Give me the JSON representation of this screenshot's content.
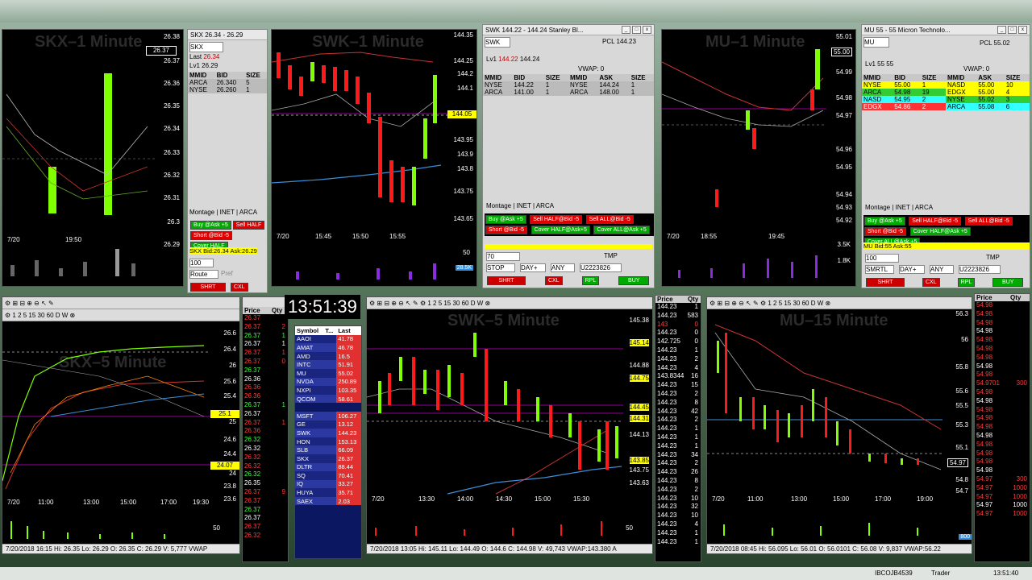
{
  "clock": "13:51:39",
  "charts": {
    "skx1": {
      "watermark": "SKX–1 Minute",
      "date": "7/20",
      "times": [
        "19:50"
      ],
      "prices": [
        "26.38",
        "26.37",
        "26.36",
        "26.35",
        "26.34",
        "26.33",
        "26.32",
        "26.31",
        "26.3",
        "26.29"
      ],
      "hl": "26.37"
    },
    "swk1": {
      "watermark": "SWK–1 Minute",
      "date": "7/20",
      "times": [
        "15:45",
        "15:50",
        "15:55"
      ],
      "prices": [
        "144.35",
        "144.25",
        "144.2",
        "144.1",
        "144.05",
        "143.95",
        "143.9",
        "143.8",
        "143.75",
        "143.65"
      ],
      "hl": "144.05",
      "vol_labels": [
        "50",
        "28.5K"
      ]
    },
    "mu1": {
      "watermark": "MU–1 Minute",
      "date": "7/20",
      "times": [
        "18:55",
        "19:45"
      ],
      "prices": [
        "55.01",
        "55.00",
        "54.99",
        "54.98",
        "54.97",
        "54.96",
        "54.95",
        "54.94",
        "54.93",
        "54.92"
      ],
      "vol_labels": [
        "3.5K",
        "1.8K"
      ]
    },
    "skx5": {
      "watermark": "SKX–5 Minute",
      "date": "7/20",
      "times": [
        "11:00",
        "13:00",
        "15:00",
        "17:00",
        "19:30"
      ],
      "prices": [
        "26.6",
        "26.4",
        "26",
        "25.6",
        "25.4",
        "25",
        "24.6",
        "24.4",
        "24",
        "23.8",
        "23.6"
      ],
      "hl": "25.1",
      "hl2": "24.07",
      "vol_label": "50",
      "status": "7/20/2018 16:15  Hi: 26.35  Lo: 26.29  O: 26.35  C: 26.29  V: 5,777  VWAP"
    },
    "swk5": {
      "watermark": "SWK–5 Minute",
      "date": "7/20",
      "times": [
        "13:30",
        "14:00",
        "14:30",
        "15:00",
        "15:30"
      ],
      "prices": [
        "145.38",
        "145.14",
        "144.88",
        "144.75",
        "144.45",
        "144.31",
        "144.13",
        "143.85",
        "143.75",
        "143.63"
      ],
      "vol_label": "50",
      "status": "7/20/2018 13:05  Hi: 145.11  Lo: 144.49  O: 144.6  C: 144.98  V: 49,743  VWAP:143.380  A"
    },
    "mu15": {
      "watermark": "MU–15 Minute",
      "date": "7/20",
      "times": [
        "11:00",
        "13:00",
        "15:00",
        "17:00",
        "19:00"
      ],
      "prices": [
        "56.3",
        "56",
        "55.8",
        "55.6",
        "55.5",
        "55.3",
        "55.1",
        "54.97",
        "54.8",
        "54.7"
      ],
      "vol_label": "800",
      "status": "7/20/2018 08:45  Hi: 56.095  Lo: 56.01  O: 56.0101  C: 56.08  V: 9,837  VWAP:56.22"
    }
  },
  "skx_lv2": {
    "title": "SKX  26.34 - 26.29",
    "symbol": "SKX",
    "last": "26.34",
    "lv1": "26.29",
    "cols": [
      "MMID",
      "BID",
      "SIZE"
    ],
    "rows": [
      [
        "ARCA",
        "26.340",
        "5"
      ],
      [
        "NYSE",
        "26.260",
        "1"
      ]
    ],
    "tabs": [
      "Montage",
      "INET",
      "ARCA"
    ],
    "bidask": "SKX Bid:26.34 Ask:26.29",
    "shares": "100",
    "route": "Route",
    "pref": "Pref",
    "shrt": "SHRT",
    "cxl": "CXL",
    "buy_ask": "Buy @Ask +5",
    "sell_half": "Sell HALF",
    "short_bid": "Short @Bid -5",
    "cover_half": "Cover HALF"
  },
  "swk_lv2": {
    "title": "SWK   144.22 - 144.24   Stanley Bl...",
    "symbol": "SWK",
    "pcl": "PCL 144.23",
    "lv1_bid": "144.22",
    "lv1_ask": "144.24",
    "vwap": "VWAP: 0",
    "cols": [
      "MMID",
      "BID",
      "SIZE",
      "MMID",
      "ASK",
      "SIZE"
    ],
    "rows": [
      [
        "NYSE",
        "144.22",
        "1",
        "NYSE",
        "144.24",
        "1"
      ],
      [
        "ARCA",
        "141.00",
        "1",
        "ARCA",
        "148.00",
        "1"
      ]
    ],
    "tabs": [
      "Montage",
      "INET",
      "ARCA"
    ],
    "buttons": [
      "Buy @Ask +5",
      "Sell HALF@Bid -5",
      "Sell ALL@Bid -5",
      "Short @Bid -5",
      "Cover HALF@Ask+5",
      "Cover ALL@Ask +5"
    ],
    "shares": "70",
    "order_type": "STOP",
    "tif": "DAY+",
    "dest": "ANY",
    "acct": "U2223826",
    "tmp": "TMP",
    "shrt": "SHRT",
    "cxl": "CXL",
    "rpl": "RPL",
    "buy": "BUY"
  },
  "mu_lv2": {
    "title": "MU   55 - 55   Micron Technolo...",
    "symbol": "MU",
    "pcl": "PCL 55.02",
    "lv1_bid": "55",
    "lv1_ask": "55",
    "vwap": "VWAP: 0",
    "cols": [
      "MMID",
      "BID",
      "SIZE",
      "MMID",
      "ASK",
      "SIZE"
    ],
    "rows": [
      [
        "NYSE",
        "55.00",
        "1",
        "NASD",
        "55.00",
        "10"
      ],
      [
        "ARCA",
        "54.98",
        "19",
        "EDGX",
        "55.00",
        "4"
      ],
      [
        "NASD",
        "54.95",
        "2",
        "NYSE",
        "55.02",
        "3"
      ],
      [
        "EDGX",
        "54.86",
        "2",
        "ARCA",
        "55.08",
        "6"
      ]
    ],
    "tabs": [
      "Montage",
      "INET",
      "ARCA"
    ],
    "buttons": [
      "Buy @Ask +5",
      "Sell HALF@Bid -5",
      "Sell ALL@Bid -5",
      "Short @Bid -5",
      "Cover HALF@Ask +5",
      "Cover ALL@Ask +5"
    ],
    "bidask": "MU Bid:55 Ask:55",
    "shares": "100",
    "dest": "SMRTL",
    "tif": "DAY+",
    "any": "ANY",
    "acct": "U2223826",
    "tmp": "TMP",
    "shrt": "SHRT",
    "cxl": "CXL",
    "rpl": "RPL",
    "buy": "BUY"
  },
  "ts_left": {
    "header": [
      "Price",
      "Qty"
    ],
    "prices": [
      "26.37",
      "26.37",
      "26.37",
      "26.37",
      "26.37",
      "26.37",
      "26.37",
      "26.36",
      "26.36",
      "26.36",
      "26.37",
      "26.37",
      "26.37",
      "26.36",
      "26.32",
      "26.32",
      "26.32",
      "26.32",
      "26.32",
      "26.35",
      "26.37",
      "26.37",
      "26.37",
      "26.37",
      "26.37",
      "26.32"
    ],
    "qtys": [
      "",
      "2",
      "1",
      "1",
      "1",
      "0",
      "",
      "",
      "",
      "",
      "1",
      "",
      "1",
      "",
      "",
      "",
      "",
      "",
      "",
      "",
      "9",
      "",
      "",
      "",
      "",
      ""
    ]
  },
  "ticker": {
    "headers": [
      "Symbol",
      "T...",
      "Last"
    ],
    "rows": [
      [
        "AAOI",
        "41.78"
      ],
      [
        "AMAT",
        "46.78"
      ],
      [
        "AMD",
        "16.5"
      ],
      [
        "INTC",
        "51.91"
      ],
      [
        "MU",
        "55.02"
      ],
      [
        "NVDA",
        "250.89"
      ],
      [
        "NXPI",
        "103.35"
      ],
      [
        "QCOM",
        "58.61"
      ],
      [
        "",
        ""
      ],
      [
        "MSFT",
        "106.27"
      ],
      [
        "GE",
        "13.12"
      ],
      [
        "SWK",
        "144.23"
      ],
      [
        "HON",
        "153.13"
      ],
      [
        "SLB",
        "66.09"
      ],
      [
        "SKX",
        "26.37"
      ],
      [
        "DLTR",
        "88.44"
      ],
      [
        "SQ",
        "70.41"
      ],
      [
        "IQ",
        "33.27"
      ],
      [
        "HUYA",
        "35.71"
      ],
      [
        "SAEX",
        "2.03"
      ]
    ]
  },
  "ts_mid": {
    "header": [
      "Price",
      "Qty"
    ],
    "rows": [
      [
        "144.23",
        "1"
      ],
      [
        "144.23",
        "583"
      ],
      [
        "143",
        "0"
      ],
      [
        "144.23",
        "0"
      ],
      [
        "142.725",
        "0"
      ],
      [
        "144.23",
        "1"
      ],
      [
        "144.23",
        "2"
      ],
      [
        "144.23",
        "4"
      ],
      [
        "143.8344",
        "16"
      ],
      [
        "144.23",
        "15"
      ],
      [
        "144.23",
        "2"
      ],
      [
        "144.23",
        "8"
      ],
      [
        "144.23",
        "42"
      ],
      [
        "144.23",
        "2"
      ],
      [
        "144.23",
        "1"
      ],
      [
        "144.23",
        "1"
      ],
      [
        "144.23",
        "1"
      ],
      [
        "144.23",
        "34"
      ],
      [
        "144.23",
        "2"
      ],
      [
        "144.23",
        "26"
      ],
      [
        "144.23",
        "8"
      ],
      [
        "144.23",
        "2"
      ],
      [
        "144.23",
        "10"
      ],
      [
        "144.23",
        "32"
      ],
      [
        "144.23",
        "10"
      ],
      [
        "144.23",
        "4"
      ],
      [
        "144.23",
        "1"
      ],
      [
        "144.23",
        "1"
      ]
    ]
  },
  "ts_right": {
    "header": [
      "Price",
      "Qty"
    ],
    "prices": [
      "54.98",
      "54.98",
      "54.98",
      "54.98",
      "54.98",
      "54.98",
      "54.98",
      "54.98",
      "54.98",
      "54.9701",
      "54.98",
      "54.98",
      "54.98",
      "54.98",
      "54.98",
      "54.98",
      "54.98",
      "54.98",
      "54.98",
      "54.98",
      "54.97",
      "54.97",
      "54.97",
      "54.97",
      "54.97"
    ],
    "qtys": [
      "",
      "",
      "",
      "",
      "",
      "",
      "",
      "",
      "",
      "300",
      "",
      "",
      "",
      "",
      "",
      "",
      "",
      "",
      "",
      "",
      "300",
      "1000",
      "1000",
      "1000",
      "1000"
    ]
  },
  "taskbar": {
    "account": "IBCOJB4539",
    "app": "Trader",
    "time": "13:51:40"
  }
}
